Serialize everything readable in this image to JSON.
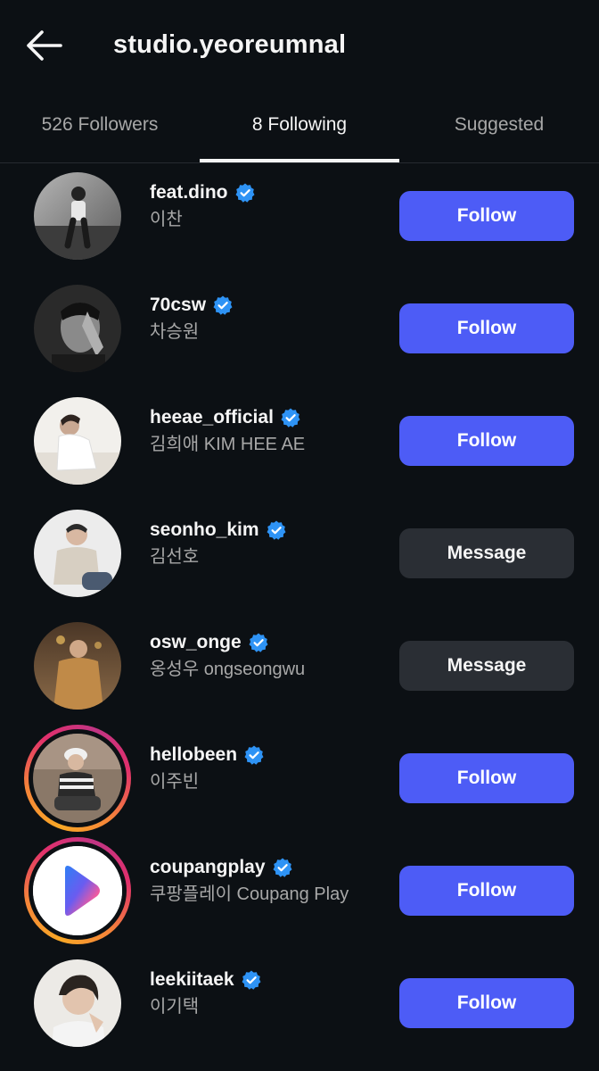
{
  "header": {
    "title": "studio.yeoreumnal",
    "back_icon": "arrow-left-icon"
  },
  "tabs": [
    {
      "label": "526 Followers",
      "active": false
    },
    {
      "label": "8 Following",
      "active": true
    },
    {
      "label": "Suggested",
      "active": false
    }
  ],
  "colors": {
    "background": "#0c1014",
    "follow_button": "#4d5cf6",
    "message_button": "#2a2e34",
    "verified_badge": "#2e93f5",
    "secondary_text": "#a8a8a8"
  },
  "following": [
    {
      "username": "feat.dino",
      "fullname": "이찬",
      "verified": true,
      "button": "Follow",
      "story": false
    },
    {
      "username": "70csw",
      "fullname": "차승원",
      "verified": true,
      "button": "Follow",
      "story": false
    },
    {
      "username": "heeae_official",
      "fullname": "김희애 KIM HEE AE",
      "verified": true,
      "button": "Follow",
      "story": false
    },
    {
      "username": "seonho_kim",
      "fullname": "김선호",
      "verified": true,
      "button": "Message",
      "story": false
    },
    {
      "username": "osw_onge",
      "fullname": "옹성우 ongseongwu",
      "verified": true,
      "button": "Message",
      "story": false
    },
    {
      "username": "hellobeen",
      "fullname": "이주빈",
      "verified": true,
      "button": "Follow",
      "story": true
    },
    {
      "username": "coupangplay",
      "fullname": "쿠팡플레이 Coupang Play",
      "verified": true,
      "button": "Follow",
      "story": true
    },
    {
      "username": "leekiitaek",
      "fullname": "이기택",
      "verified": true,
      "button": "Follow",
      "story": false
    }
  ]
}
